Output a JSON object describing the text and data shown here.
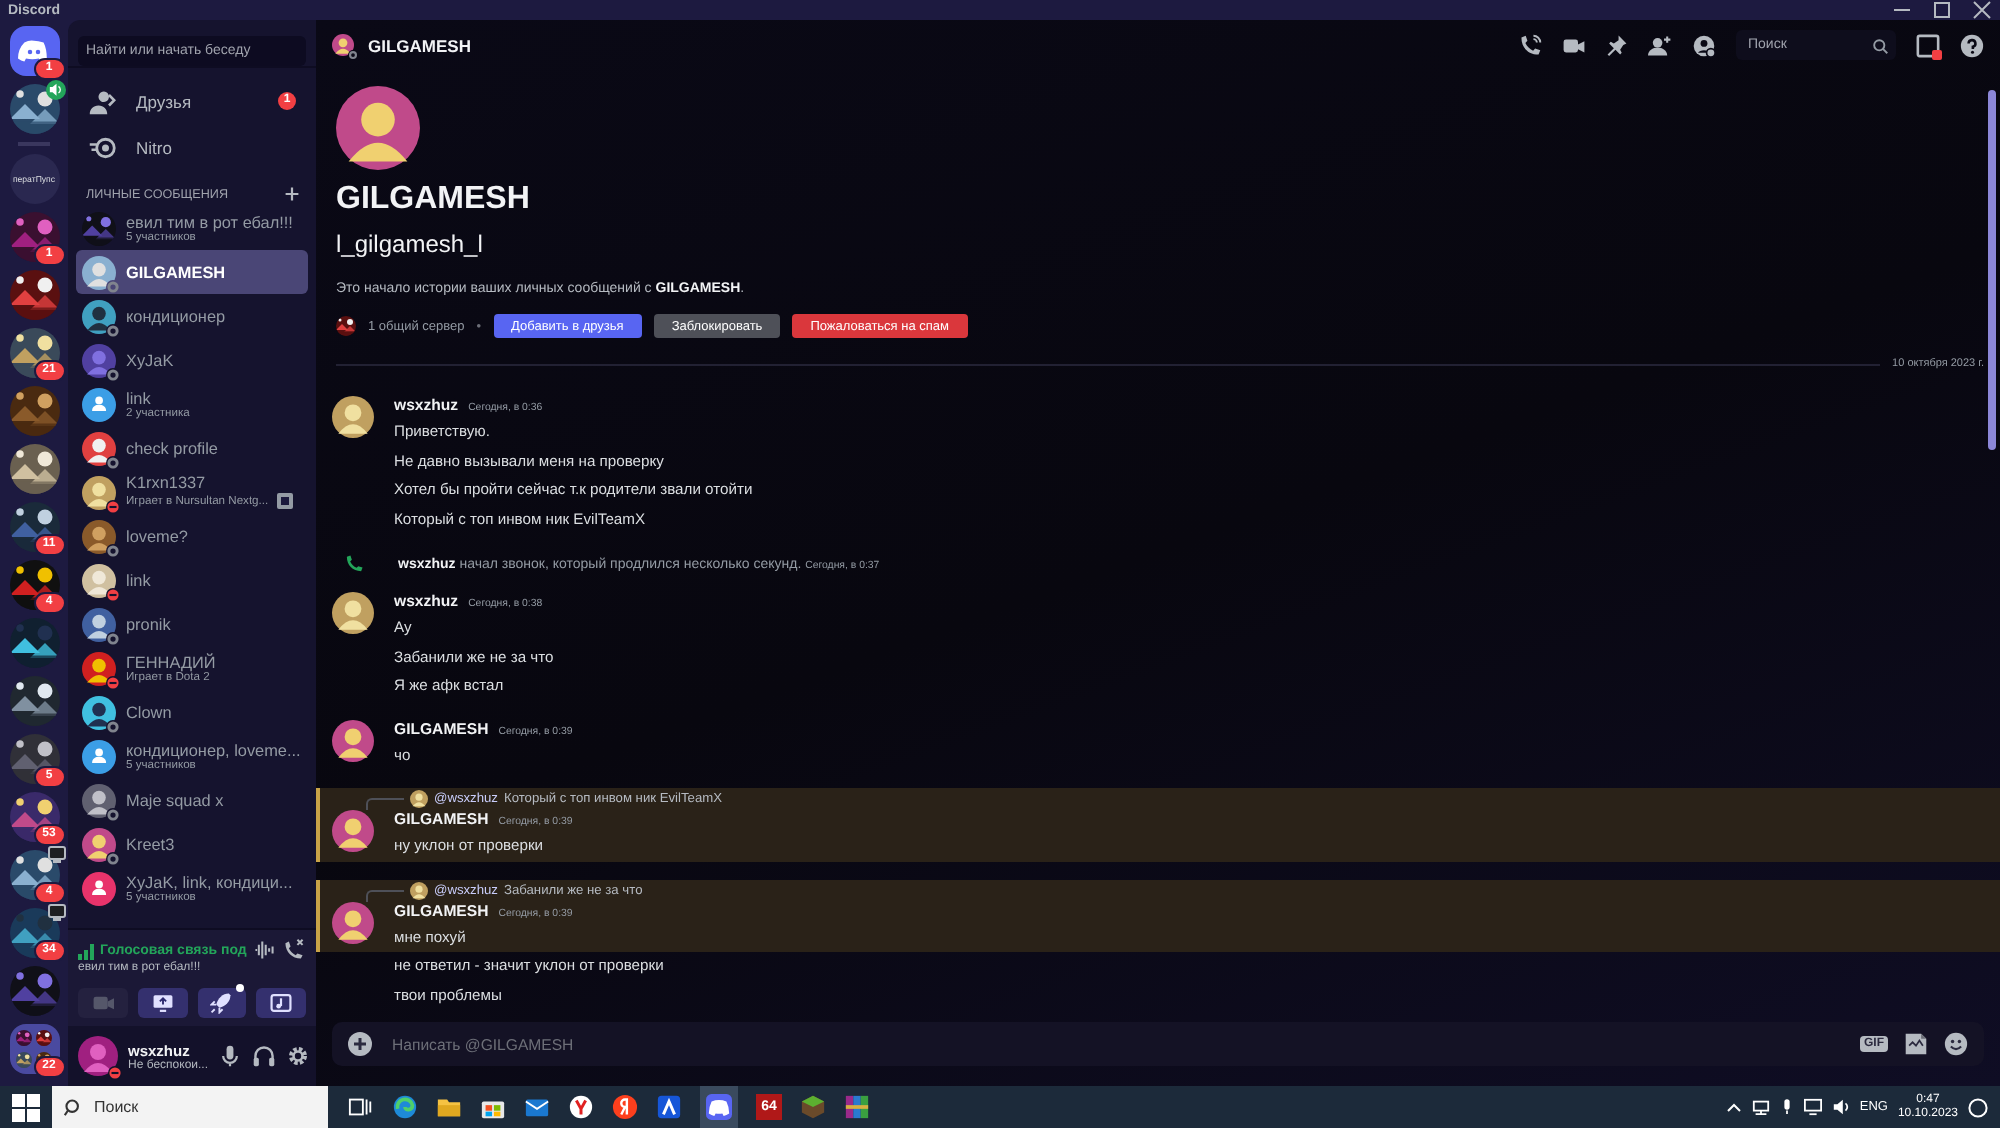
{
  "window": {
    "title": "Discord"
  },
  "servers": [
    {
      "kind": "home",
      "badge": "1"
    },
    {
      "kind": "avatar",
      "speaking": true
    },
    {
      "kind": "divider"
    },
    {
      "kind": "text",
      "label": "ператПупс"
    },
    {
      "kind": "picture",
      "badge": "1"
    },
    {
      "kind": "picture"
    },
    {
      "kind": "picture",
      "badge": "21"
    },
    {
      "kind": "picture"
    },
    {
      "kind": "picture"
    },
    {
      "kind": "picture",
      "badge": "11"
    },
    {
      "kind": "picture",
      "badge": "4"
    },
    {
      "kind": "picture"
    },
    {
      "kind": "picture"
    },
    {
      "kind": "picture",
      "badge": "5"
    },
    {
      "kind": "picture",
      "badge": "53"
    },
    {
      "kind": "picture",
      "badge": "4",
      "live": true
    },
    {
      "kind": "picture",
      "badge": "34",
      "live": true
    },
    {
      "kind": "picture"
    },
    {
      "kind": "folder",
      "badge": "22"
    }
  ],
  "sidebar": {
    "search": {
      "placeholder": "Найти или начать беседу"
    },
    "nav": [
      {
        "kind": "friends",
        "label": "Друзья",
        "badge": "1"
      },
      {
        "kind": "nitro",
        "label": "Nitro"
      }
    ],
    "section": "ЛИЧНЫЕ СООБЩЕНИЯ",
    "dms": [
      {
        "kind": "group-picture",
        "name": "евил тим в рот ебал!!!",
        "subtitle": "5 участников",
        "selected": false
      },
      {
        "kind": "user",
        "name": "GILGAMESH",
        "dnd": false,
        "selected": true
      },
      {
        "kind": "user",
        "name": "кондиционер",
        "dnd": false,
        "selected": false
      },
      {
        "kind": "user",
        "name": "XyJaK",
        "dnd": false,
        "selected": false
      },
      {
        "kind": "group",
        "name": "link",
        "subtitle": "2 участника",
        "color": "#3b9ee6",
        "selected": false
      },
      {
        "kind": "user",
        "name": "check profile",
        "dnd": false,
        "selected": false
      },
      {
        "kind": "user",
        "name": "K1rxn1337",
        "subtitle": "Играет в Nursultan Nextg...",
        "dnd": true,
        "game": true,
        "selected": false
      },
      {
        "kind": "user",
        "name": "loveme?",
        "dnd": false,
        "selected": false
      },
      {
        "kind": "user",
        "name": "link",
        "dnd": true,
        "selected": false
      },
      {
        "kind": "user",
        "name": "pronik",
        "dnd": false,
        "selected": false
      },
      {
        "kind": "user",
        "name": "ГЕННАДИЙ",
        "subtitle": "Играет в Dota 2",
        "dnd": true,
        "selected": false
      },
      {
        "kind": "user",
        "name": "Clown",
        "dnd": false,
        "selected": false
      },
      {
        "kind": "group",
        "name": "кондиционер, loveme...",
        "subtitle": "5 участников",
        "color": "#3b9ee6",
        "selected": false
      },
      {
        "kind": "user",
        "name": "Maje squad x",
        "dnd": false,
        "selected": false
      },
      {
        "kind": "user",
        "name": "Kreet3",
        "dnd": false,
        "selected": false
      },
      {
        "kind": "group",
        "name": "XyJaK, link, кондици...",
        "subtitle": "5 участников",
        "color": "#e8336b",
        "selected": false
      }
    ],
    "voice": {
      "status": "Голосовая связь под",
      "channel": "евил тим в рот ебал!!!",
      "buttons": [
        {
          "kind": "camera",
          "disabled": true
        },
        {
          "kind": "screen",
          "disabled": false
        },
        {
          "kind": "activity",
          "disabled": false,
          "dot": true
        },
        {
          "kind": "soundboard",
          "disabled": false
        }
      ]
    },
    "user": {
      "name": "wsxzhuz",
      "status_text": "Не беспокои...",
      "dnd": true
    }
  },
  "header": {
    "name": "GILGAMESH",
    "dnd": false,
    "search_placeholder": "Поиск",
    "inbox_unread": true
  },
  "intro": {
    "name": "GILGAMESH",
    "handle": "l_gilgamesh_l",
    "text": "Это начало истории ваших личных сообщений с **GILGAMESH**.",
    "mutual": "1 общий сервер",
    "separator": "•",
    "buttons": [
      {
        "kind": "primary",
        "label": "Добавить в друзья"
      },
      {
        "kind": "secondary",
        "label": "Заблокировать"
      },
      {
        "kind": "danger",
        "label": "Пожаловаться на спам"
      }
    ]
  },
  "date_divider": "10 октября 2023 г.",
  "messages": [
    {
      "kind": "group",
      "author": "wsxzhuz",
      "time": "Сегодня, в 0:36",
      "lines": [
        {
          "text": "Приветствую.",
          "highlighted": false
        },
        {
          "text": "Не давно вызывали меня на проверку",
          "highlighted": false
        },
        {
          "text": "Хотел бы пройти сейчас т.к родители звали отойти",
          "highlighted": false
        },
        {
          "text": "Который с топ инвом ник EvilTeamX",
          "highlighted": false
        }
      ]
    },
    {
      "kind": "call",
      "author": "wsxzhuz",
      "text": "начал звонок, который продлился несколько секунд.",
      "time": "Сегодня, в 0:37"
    },
    {
      "kind": "group",
      "author": "wsxzhuz",
      "time": "Сегодня, в 0:38",
      "lines": [
        {
          "text": "Ау",
          "highlighted": false
        },
        {
          "text": "Забанили же не за что",
          "highlighted": false
        },
        {
          "text": "Я же афк встал",
          "highlighted": false
        }
      ]
    },
    {
      "kind": "group",
      "author": "GILGAMESH",
      "time": "Сегодня, в 0:39",
      "lines": [
        {
          "text": "чо",
          "highlighted": false
        }
      ]
    },
    {
      "kind": "group",
      "author": "GILGAMESH",
      "time": "Сегодня, в 0:39",
      "reply": {
        "author": "@wsxzhuz",
        "text": "Который с топ инвом ник EvilTeamX"
      },
      "lines": [
        {
          "text": "ну уклон от проверки",
          "highlighted": true
        }
      ]
    },
    {
      "kind": "group",
      "author": "GILGAMESH",
      "time": "Сегодня, в 0:39",
      "reply": {
        "author": "@wsxzhuz",
        "text": "Забанили же не за что"
      },
      "lines": [
        {
          "text": "мне похуй",
          "highlighted": true
        },
        {
          "text": "не ответил - значит уклон от проверки",
          "highlighted": false
        },
        {
          "text": "твои проблемы",
          "highlighted": false
        }
      ]
    }
  ],
  "composer": {
    "placeholder": "Написать @GILGAMESH",
    "gif": "GIF"
  },
  "taskbar": {
    "search": "Поиск",
    "apps": [
      {
        "kind": "task-view"
      },
      {
        "kind": "browser"
      },
      {
        "kind": "folder"
      },
      {
        "kind": "store"
      },
      {
        "kind": "mail"
      },
      {
        "kind": "y-browser"
      },
      {
        "kind": "y-letter"
      },
      {
        "kind": "blue-app"
      },
      {
        "kind": "discord",
        "active": true
      },
      {
        "kind": "tile",
        "label": "64"
      },
      {
        "kind": "cube"
      },
      {
        "kind": "archive"
      }
    ],
    "lang": "ENG",
    "time": "0:47",
    "date": "10.10.2023"
  }
}
